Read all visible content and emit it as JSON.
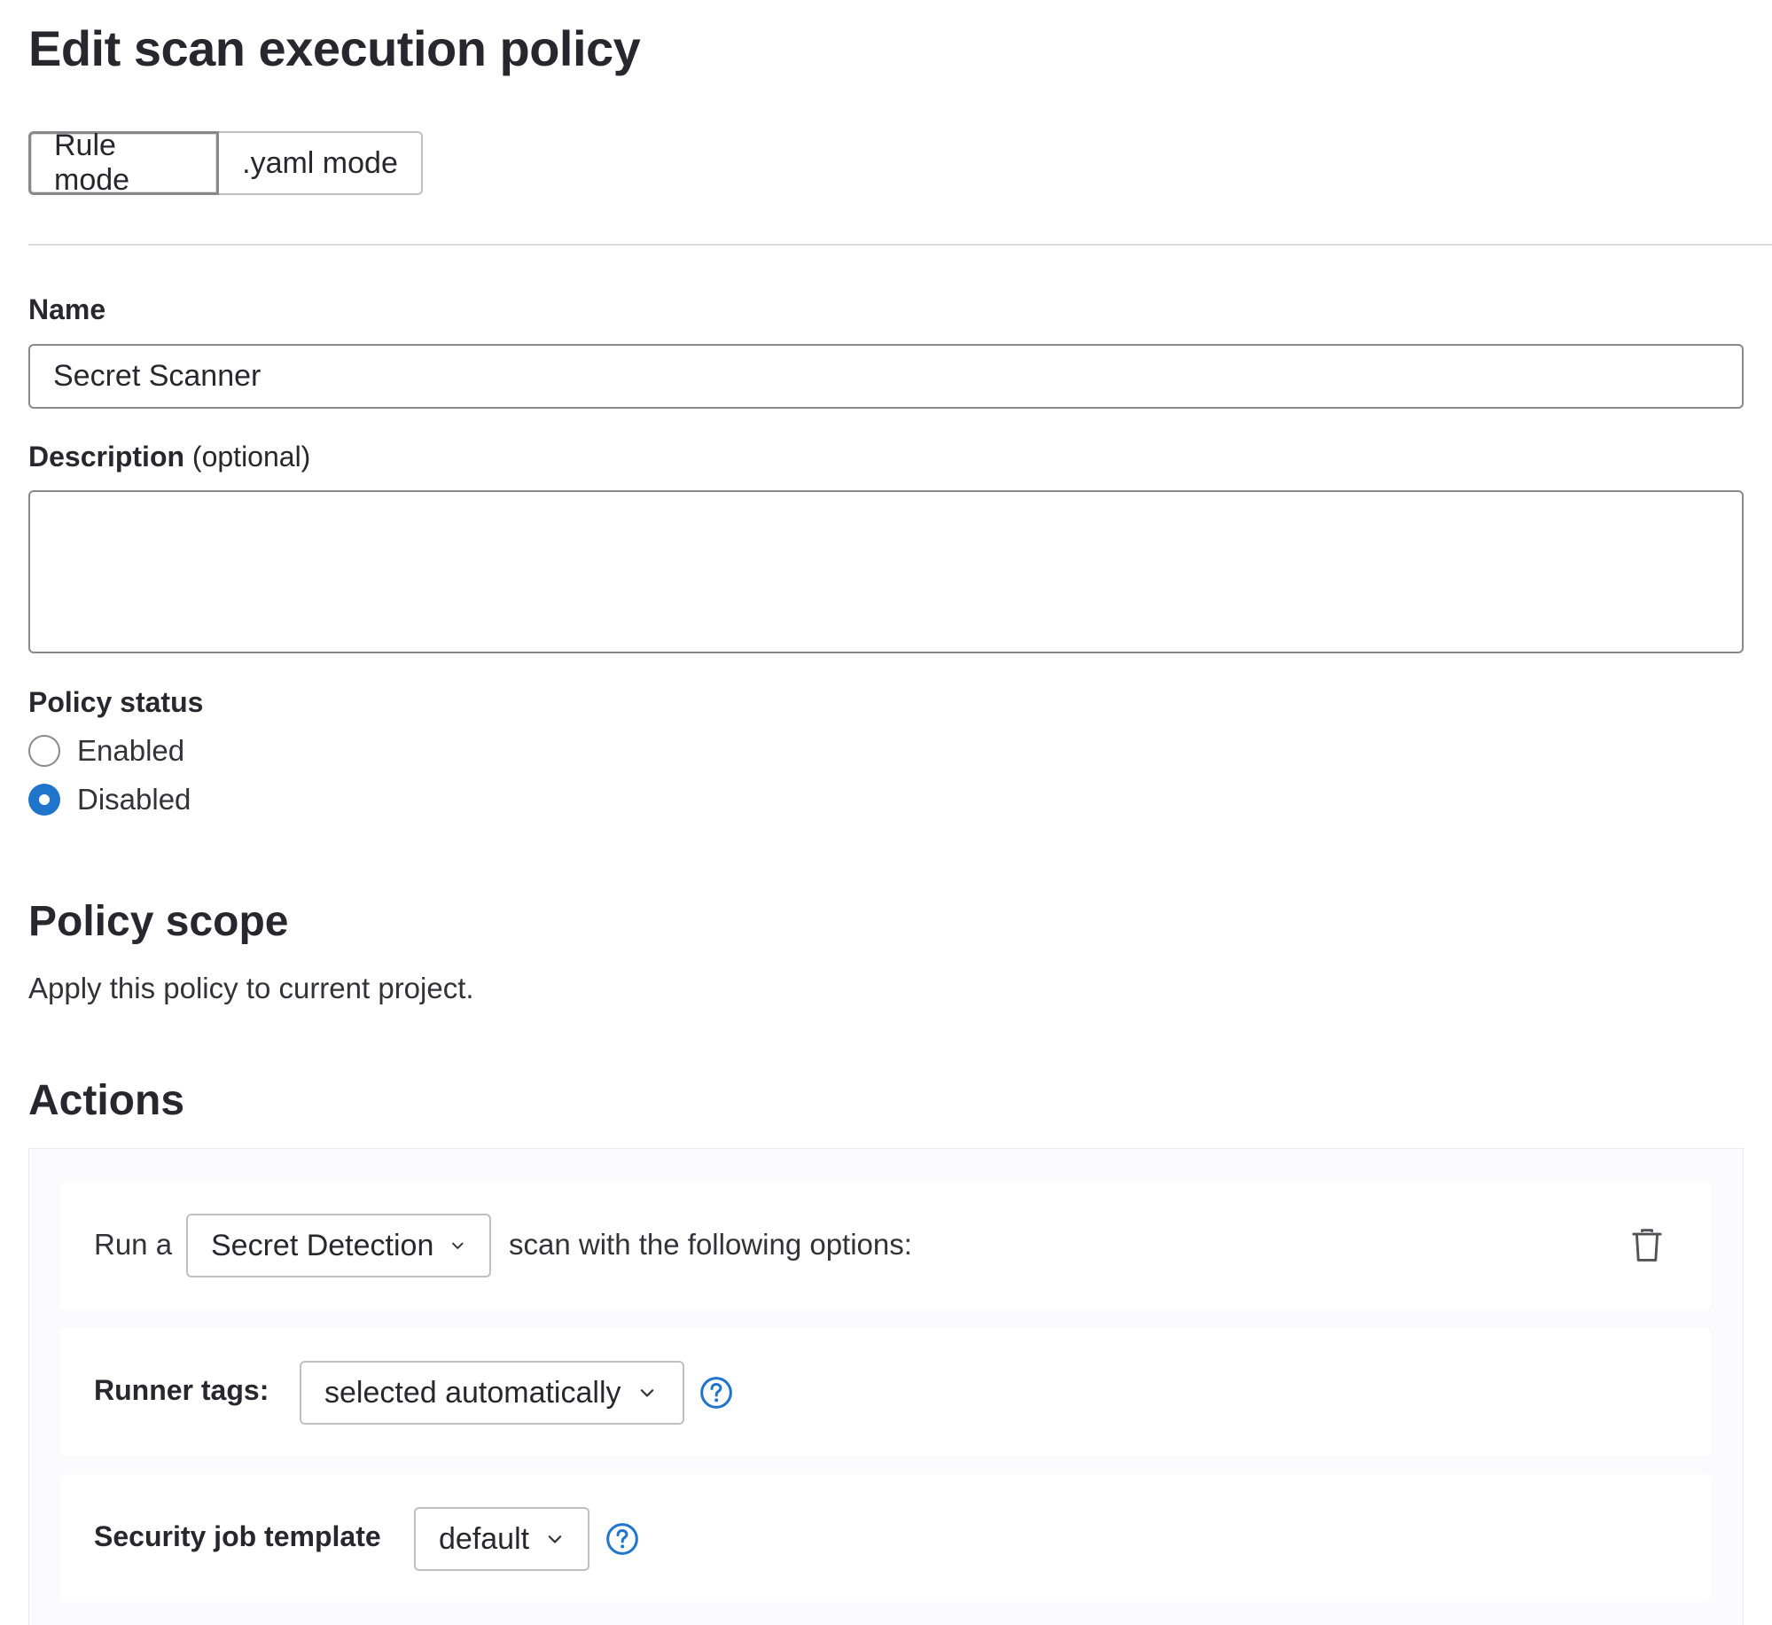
{
  "page": {
    "title": "Edit scan execution policy"
  },
  "mode_toggle": {
    "rule_mode_label": "Rule mode",
    "yaml_mode_label": ".yaml mode",
    "selected": "Rule mode"
  },
  "form": {
    "name_label": "Name",
    "name_value": "Secret Scanner",
    "description_label": "Description",
    "description_optional": "(optional)",
    "description_value": "",
    "status_label": "Policy status",
    "status_options": [
      {
        "label": "Enabled",
        "checked": false
      },
      {
        "label": "Disabled",
        "checked": true
      }
    ]
  },
  "scope": {
    "heading": "Policy scope",
    "text": "Apply this policy to current project."
  },
  "actions": {
    "heading": "Actions",
    "scan_row": {
      "prefix": "Run a",
      "scanner": "Secret Detection",
      "suffix": "scan with the following options:"
    },
    "runner_tags": {
      "label": "Runner tags:",
      "value": "selected automatically"
    },
    "job_template": {
      "label": "Security job template",
      "value": "default"
    }
  },
  "colors": {
    "accent": "#1f75cb",
    "text": "#333238",
    "heading": "#28272d",
    "border": "#89888d"
  },
  "icons": {
    "trash": "trash-icon",
    "help": "question-circle-icon",
    "chevron": "chevron-down-icon"
  }
}
